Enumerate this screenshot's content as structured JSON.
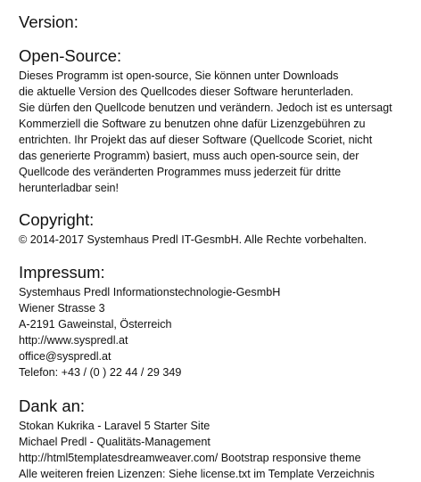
{
  "version": {
    "title": "Version:"
  },
  "open_source": {
    "title": "Open-Source:",
    "lines": [
      "Dieses Programm ist open-source, Sie können unter Downloads",
      "die aktuelle Version des Quellcodes dieser Software herunterladen.",
      "Sie dürfen den Quellcode benutzen und verändern. Jedoch ist es untersagt",
      "Kommerziell die Software zu benutzen ohne dafür Lizenzgebühren zu",
      "entrichten. Ihr Projekt das auf dieser Software (Quellcode Scoriet, nicht",
      "das generierte Programm) basiert, muss auch open-source sein, der",
      "Quellcode des veränderten Programmes muss jederzeit für dritte",
      "herunterladbar sein!"
    ]
  },
  "copyright": {
    "title": "Copyright:",
    "text": "© 2014-2017 Systemhaus Predl IT-GesmbH. Alle Rechte vorbehalten."
  },
  "impressum": {
    "title": "Impressum:",
    "company": "Systemhaus Predl Informationstechnologie-GesmbH",
    "street": "Wiener Strasse 3",
    "city": "A-2191 Gaweinstal, Österreich",
    "website": "http://www.syspredl.at",
    "email": "office@syspredl.at",
    "phone": "Telefon: +43 / (0 ) 22 44 / 29 349"
  },
  "dank": {
    "title": "Dank an:",
    "lines": [
      "Stokan Kukrika - Laravel 5 Starter Site",
      "Michael Predl - Qualitäts-Management",
      "http://html5templatesdreamweaver.com/ Bootstrap responsive theme",
      "Alle weiteren freien Lizenzen: Siehe license.txt im Template Verzeichnis"
    ]
  }
}
